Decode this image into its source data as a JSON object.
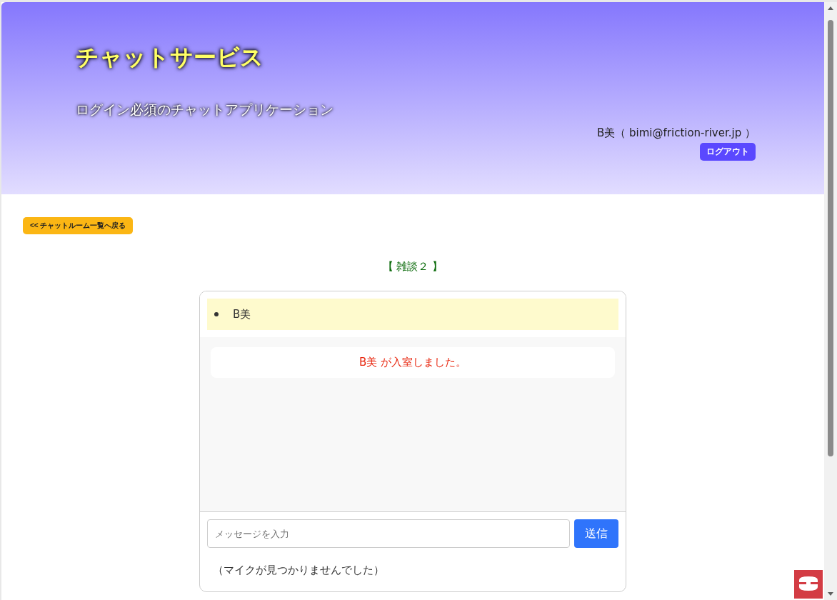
{
  "header": {
    "title": "チャットサービス",
    "subtitle": "ログイン必須のチャットアプリケーション",
    "user": "B美（ bimi@friction-river.jp ）",
    "logout": "ログアウト"
  },
  "back_button": "<< チャットルーム一覧へ戻る",
  "room_title": "【 雑談２ 】",
  "members": [
    {
      "name": "B美"
    }
  ],
  "messages": [
    {
      "kind": "system",
      "text": "B美 が入室しました。"
    }
  ],
  "composer": {
    "placeholder": "メッセージを入力",
    "send": "送信"
  },
  "mic_status": "（マイクが見つかりませんでした）"
}
